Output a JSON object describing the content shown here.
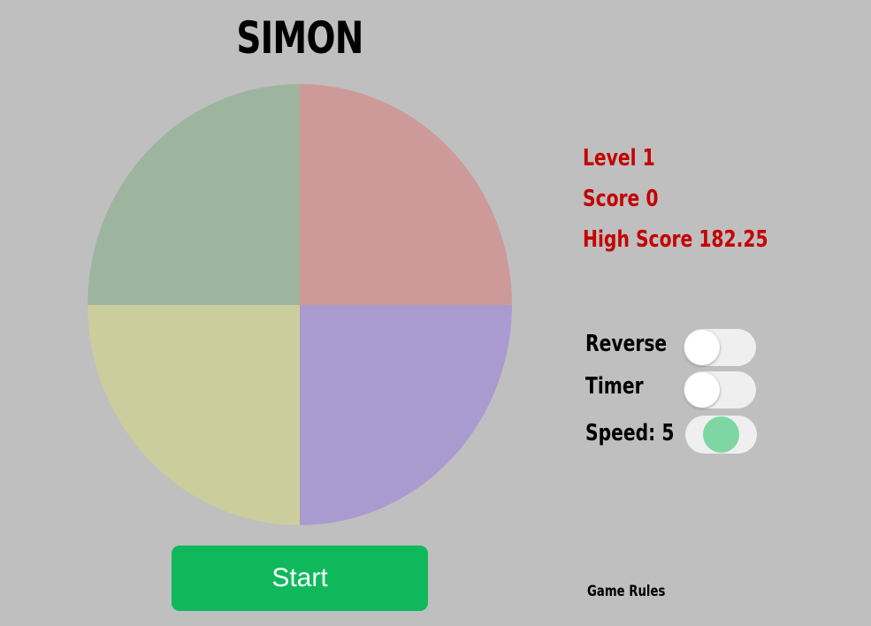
{
  "game": {
    "title": "SIMON"
  },
  "board": {
    "colors": {
      "green": "#9db59f",
      "red": "#cd9a99",
      "yellow": "#cccd9d",
      "blue": "#a99bcf"
    }
  },
  "stats": {
    "level_label": "Level 1",
    "score_label": "Score 0",
    "high_score_label": "High Score 182.25",
    "color": "#c40000"
  },
  "options": {
    "reverse_label": "Reverse",
    "reverse_on": false,
    "timer_label": "Timer",
    "timer_on": false,
    "speed_label": "Speed: 5",
    "speed_value": 5,
    "speed_min": 1,
    "speed_max": 9,
    "speed_thumb_color": "#7ed6a2"
  },
  "start_button": {
    "label": "Start",
    "color": "#10b85c"
  },
  "footer": {
    "rules_link": "Game Rules"
  }
}
